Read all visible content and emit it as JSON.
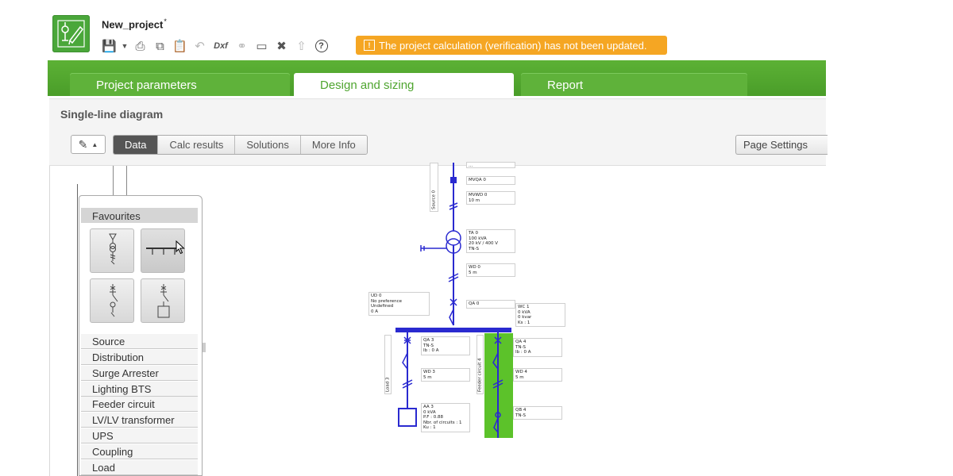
{
  "project": {
    "name": "New_project",
    "modified_mark": "*"
  },
  "toolbar": {
    "icons": [
      "save-icon",
      "dropdown-caret-icon",
      "print-icon",
      "copy-icon",
      "paste-icon",
      "undo-icon",
      "dxf-export-icon",
      "link-icon",
      "package-icon",
      "tools-icon",
      "upload-icon",
      "help-icon"
    ],
    "dxf_label": "Dxf",
    "help_glyph": "?"
  },
  "warning": {
    "text": "The project calculation (verification) has not been updated.",
    "color": "#f5a623"
  },
  "tabs": [
    {
      "label": "Project parameters",
      "active": false
    },
    {
      "label": "Design and sizing",
      "active": true
    },
    {
      "label": "Report",
      "active": false
    }
  ],
  "panel": {
    "title": "Single-line diagram",
    "view_buttons": [
      {
        "label": "Data",
        "active": true
      },
      {
        "label": "Calc results",
        "active": false
      },
      {
        "label": "Solutions",
        "active": false
      },
      {
        "label": "More Info",
        "active": false
      }
    ],
    "page_settings_label": "Page Settings"
  },
  "palette": {
    "favourites_label": "Favourites",
    "favourite_tiles": [
      "source-transformer-symbol-icon",
      "busbar-symbol-icon",
      "feeder-breaker-symbol-icon",
      "feeder-load-symbol-icon"
    ],
    "categories": [
      "Source",
      "Distribution",
      "Surge Arrester",
      "Lighting BTS",
      "Feeder circuit",
      "LV/LV transformer",
      "UPS",
      "Coupling",
      "Load"
    ]
  },
  "diagram": {
    "colors": {
      "line": "#2a2ad0",
      "highlight": "#5cc22a"
    },
    "labels": {
      "top_partial": "...",
      "mvqa": "MVQA 0",
      "mvwd": "MVWD 0\n10 m",
      "source_vertical": "Source 0",
      "ta": "TA 0\n100 kVA\n20 kV / 400 V\nTN-S",
      "wd0": "WD 0\n5 m",
      "ud": "UD 0\nNo preference\nUndefined\n0 A",
      "qa0": "QA 0",
      "wc": "WC 1\n0 kVA\n0 kvar\nKs : 1",
      "qa3": "QA 3\nTN-S\nIb : 0 A",
      "qa4": "QA 4\nTN-S\nIb : 0 A",
      "wd3": "WD 3\n5 m",
      "wd4": "WD 4\n5 m",
      "qb4": "QB 4\nTN-S",
      "aa3": "AA 3\n0 kVA\nP.F : 0.88\nNbr. of circuits : 1\nKu : 1",
      "load_vertical": "Load 3",
      "feeder_vertical": "Feeder circuit 4"
    }
  }
}
